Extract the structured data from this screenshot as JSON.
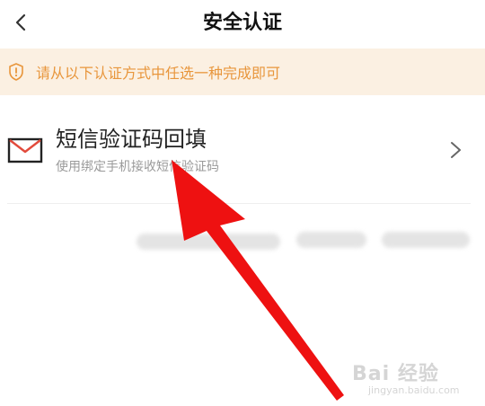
{
  "header": {
    "title": "安全认证",
    "back_icon": "chevron-left-icon"
  },
  "notice": {
    "text": "请从以下认证方式中任选一种完成即可",
    "icon": "shield-alert-icon",
    "background": "#fbf0e2",
    "color": "#e8963c"
  },
  "option": {
    "title": "短信验证码回填",
    "subtitle": "使用绑定手机接收短信验证码",
    "icon": "mail-icon",
    "chevron_icon": "chevron-right-icon"
  },
  "annotation": {
    "arrow_color": "#ee1111"
  },
  "watermark": {
    "logo": "Bai 经验",
    "sub": "jingyan.baidu.com"
  }
}
